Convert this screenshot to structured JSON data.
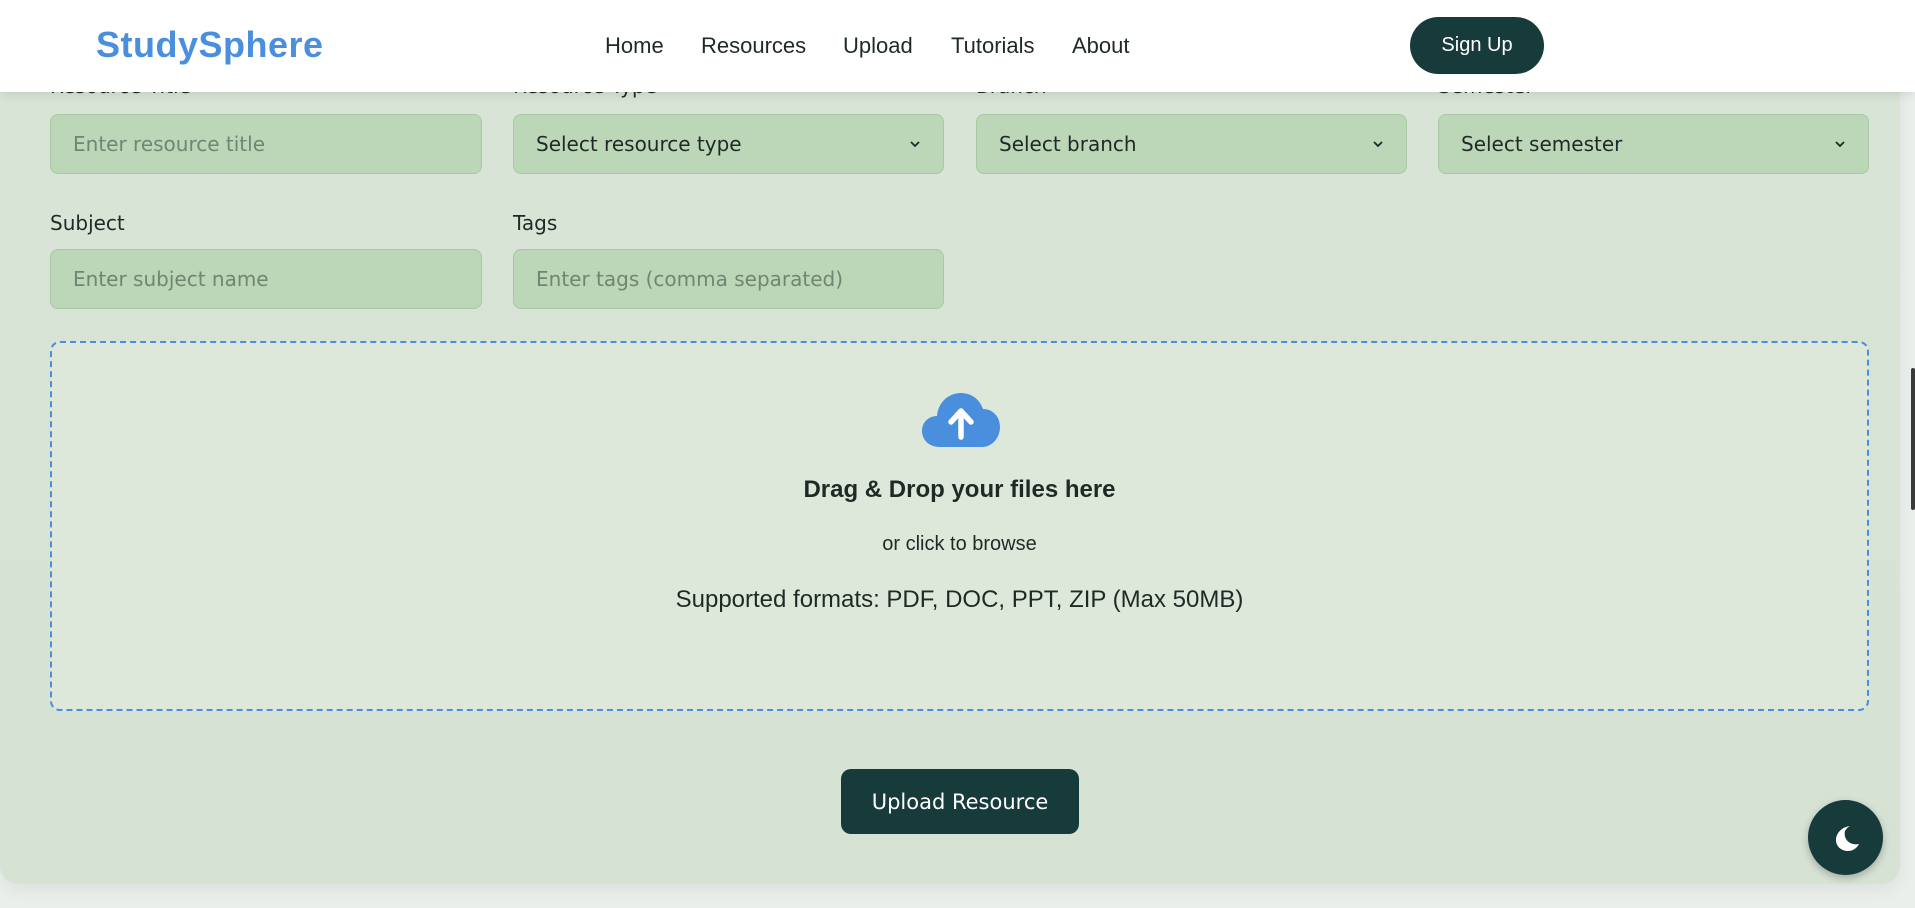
{
  "navbar": {
    "logo": "StudySphere",
    "links": [
      "Home",
      "Resources",
      "Upload",
      "Tutorials",
      "About"
    ],
    "signup_label": "Sign Up"
  },
  "form": {
    "row1": {
      "title": {
        "label": "Resource Title",
        "placeholder": "Enter resource title"
      },
      "type": {
        "label": "Resource Type",
        "selected": "Select resource type"
      },
      "branch": {
        "label": "Branch",
        "selected": "Select branch"
      },
      "semester": {
        "label": "Semester",
        "selected": "Select semester"
      }
    },
    "row2": {
      "subject": {
        "label": "Subject",
        "placeholder": "Enter subject name"
      },
      "tags": {
        "label": "Tags",
        "placeholder": "Enter tags (comma separated)"
      }
    },
    "dropzone": {
      "icon": "cloud-upload-icon",
      "title": "Drag & Drop your files here",
      "subtitle": "or click to browse",
      "formats": "Supported formats: PDF, DOC, PPT, ZIP (Max 50MB)"
    },
    "submit_label": "Upload Resource"
  },
  "theme_toggle": {
    "icon": "moon-icon"
  },
  "colors": {
    "brand_blue": "#4a8fdd",
    "dark_teal": "#173b3b",
    "field_green": "#bcd6b8",
    "page_bg": "#d8e4d6"
  }
}
